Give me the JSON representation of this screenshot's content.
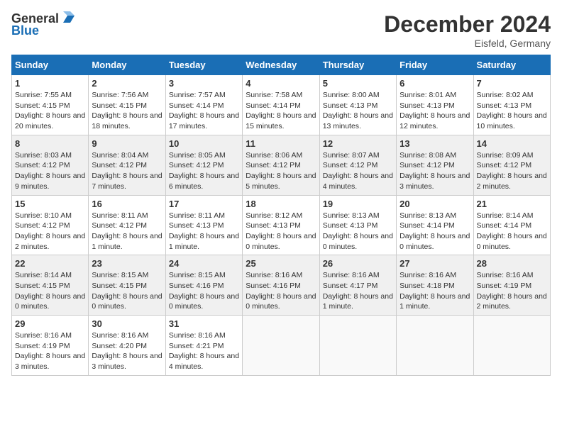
{
  "header": {
    "logo_line1": "General",
    "logo_line2": "Blue",
    "month": "December 2024",
    "location": "Eisfeld, Germany"
  },
  "weekdays": [
    "Sunday",
    "Monday",
    "Tuesday",
    "Wednesday",
    "Thursday",
    "Friday",
    "Saturday"
  ],
  "weeks": [
    [
      {
        "day": "1",
        "sunrise": "7:55 AM",
        "sunset": "4:15 PM",
        "daylight": "8 hours and 20 minutes."
      },
      {
        "day": "2",
        "sunrise": "7:56 AM",
        "sunset": "4:15 PM",
        "daylight": "8 hours and 18 minutes."
      },
      {
        "day": "3",
        "sunrise": "7:57 AM",
        "sunset": "4:14 PM",
        "daylight": "8 hours and 17 minutes."
      },
      {
        "day": "4",
        "sunrise": "7:58 AM",
        "sunset": "4:14 PM",
        "daylight": "8 hours and 15 minutes."
      },
      {
        "day": "5",
        "sunrise": "8:00 AM",
        "sunset": "4:13 PM",
        "daylight": "8 hours and 13 minutes."
      },
      {
        "day": "6",
        "sunrise": "8:01 AM",
        "sunset": "4:13 PM",
        "daylight": "8 hours and 12 minutes."
      },
      {
        "day": "7",
        "sunrise": "8:02 AM",
        "sunset": "4:13 PM",
        "daylight": "8 hours and 10 minutes."
      }
    ],
    [
      {
        "day": "8",
        "sunrise": "8:03 AM",
        "sunset": "4:12 PM",
        "daylight": "8 hours and 9 minutes."
      },
      {
        "day": "9",
        "sunrise": "8:04 AM",
        "sunset": "4:12 PM",
        "daylight": "8 hours and 7 minutes."
      },
      {
        "day": "10",
        "sunrise": "8:05 AM",
        "sunset": "4:12 PM",
        "daylight": "8 hours and 6 minutes."
      },
      {
        "day": "11",
        "sunrise": "8:06 AM",
        "sunset": "4:12 PM",
        "daylight": "8 hours and 5 minutes."
      },
      {
        "day": "12",
        "sunrise": "8:07 AM",
        "sunset": "4:12 PM",
        "daylight": "8 hours and 4 minutes."
      },
      {
        "day": "13",
        "sunrise": "8:08 AM",
        "sunset": "4:12 PM",
        "daylight": "8 hours and 3 minutes."
      },
      {
        "day": "14",
        "sunrise": "8:09 AM",
        "sunset": "4:12 PM",
        "daylight": "8 hours and 2 minutes."
      }
    ],
    [
      {
        "day": "15",
        "sunrise": "8:10 AM",
        "sunset": "4:12 PM",
        "daylight": "8 hours and 2 minutes."
      },
      {
        "day": "16",
        "sunrise": "8:11 AM",
        "sunset": "4:12 PM",
        "daylight": "8 hours and 1 minute."
      },
      {
        "day": "17",
        "sunrise": "8:11 AM",
        "sunset": "4:13 PM",
        "daylight": "8 hours and 1 minute."
      },
      {
        "day": "18",
        "sunrise": "8:12 AM",
        "sunset": "4:13 PM",
        "daylight": "8 hours and 0 minutes."
      },
      {
        "day": "19",
        "sunrise": "8:13 AM",
        "sunset": "4:13 PM",
        "daylight": "8 hours and 0 minutes."
      },
      {
        "day": "20",
        "sunrise": "8:13 AM",
        "sunset": "4:14 PM",
        "daylight": "8 hours and 0 minutes."
      },
      {
        "day": "21",
        "sunrise": "8:14 AM",
        "sunset": "4:14 PM",
        "daylight": "8 hours and 0 minutes."
      }
    ],
    [
      {
        "day": "22",
        "sunrise": "8:14 AM",
        "sunset": "4:15 PM",
        "daylight": "8 hours and 0 minutes."
      },
      {
        "day": "23",
        "sunrise": "8:15 AM",
        "sunset": "4:15 PM",
        "daylight": "8 hours and 0 minutes."
      },
      {
        "day": "24",
        "sunrise": "8:15 AM",
        "sunset": "4:16 PM",
        "daylight": "8 hours and 0 minutes."
      },
      {
        "day": "25",
        "sunrise": "8:16 AM",
        "sunset": "4:16 PM",
        "daylight": "8 hours and 0 minutes."
      },
      {
        "day": "26",
        "sunrise": "8:16 AM",
        "sunset": "4:17 PM",
        "daylight": "8 hours and 1 minute."
      },
      {
        "day": "27",
        "sunrise": "8:16 AM",
        "sunset": "4:18 PM",
        "daylight": "8 hours and 1 minute."
      },
      {
        "day": "28",
        "sunrise": "8:16 AM",
        "sunset": "4:19 PM",
        "daylight": "8 hours and 2 minutes."
      }
    ],
    [
      {
        "day": "29",
        "sunrise": "8:16 AM",
        "sunset": "4:19 PM",
        "daylight": "8 hours and 3 minutes."
      },
      {
        "day": "30",
        "sunrise": "8:16 AM",
        "sunset": "4:20 PM",
        "daylight": "8 hours and 3 minutes."
      },
      {
        "day": "31",
        "sunrise": "8:16 AM",
        "sunset": "4:21 PM",
        "daylight": "8 hours and 4 minutes."
      },
      null,
      null,
      null,
      null
    ]
  ]
}
